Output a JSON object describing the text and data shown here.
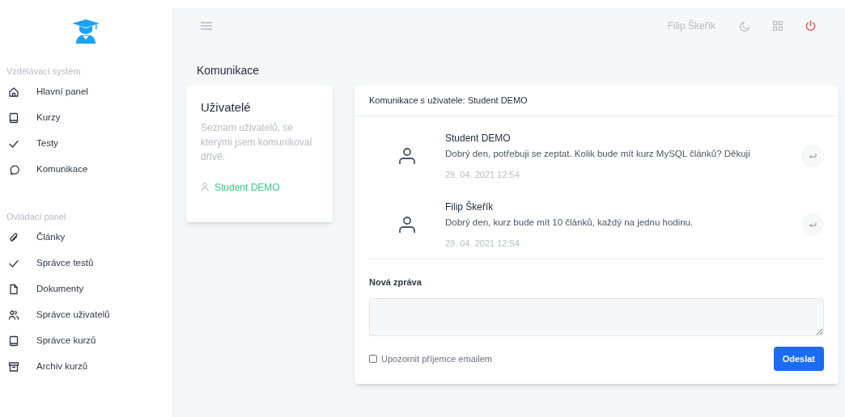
{
  "sidebar": {
    "sections": [
      {
        "title": "Vzdělávací systém",
        "items": [
          {
            "label": "Hlavní panel"
          },
          {
            "label": "Kurzy"
          },
          {
            "label": "Testy"
          },
          {
            "label": "Komunikace"
          }
        ]
      },
      {
        "title": "Ovládací panel",
        "items": [
          {
            "label": "Články"
          },
          {
            "label": "Správce testů"
          },
          {
            "label": "Dokumenty"
          },
          {
            "label": "Správce uživatelů"
          },
          {
            "label": "Správce kurzů"
          },
          {
            "label": "Archiv kurzů"
          }
        ]
      }
    ]
  },
  "topbar": {
    "user": "Filip Škeřík"
  },
  "page_title": "Komunikace",
  "users_card": {
    "title": "Uživatelé",
    "description": "Seznam uživatelů, se kterými jsem komunikoval dřívě.",
    "users": [
      "Student DEMO"
    ]
  },
  "conversation": {
    "title": "Komunikace s uživatele: Student DEMO",
    "messages": [
      {
        "author": "Student DEMO",
        "text": "Dobrý den, potřebuji se zeptat. Kolik bude mít kurz MySQL článků? Děkuji",
        "time": "29. 04. 2021 12:54"
      },
      {
        "author": "Filip Škeřík",
        "text": "Dobrý den, kurz bude mít 10 článků, každý na jednu hodinu.",
        "time": "29. 04. 2021 12:54"
      }
    ],
    "new_message": {
      "label": "Nová zpráva",
      "notify_label": "Upozornit příjemce emailem",
      "notify_checked": false,
      "send": "Odeslat"
    }
  }
}
